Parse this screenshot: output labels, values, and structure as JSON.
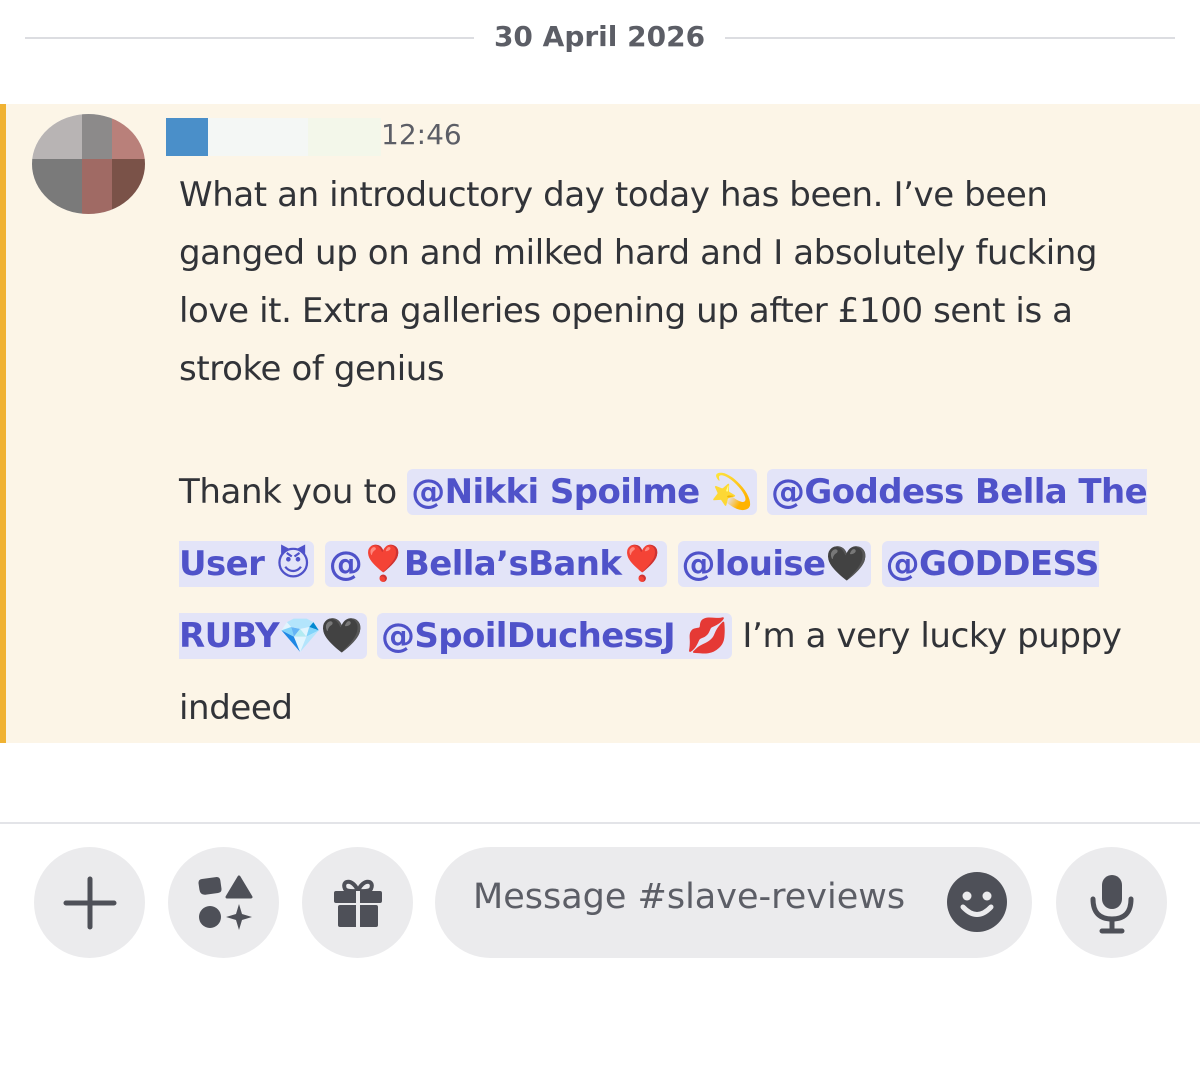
{
  "date_divider": "30 April 2026",
  "message": {
    "timestamp": "12:46",
    "paragraph1": "What an introductory day today has been. I’ve been ganged up on and milked hard and I absolutely fucking love it. Extra galleries opening up after £100 sent is a stroke of genius",
    "thanks_prefix": "Thank you to ",
    "mentions": [
      "@Nikki Spoilme 💫",
      "@Goddess Bella The User 😈",
      "@❣️Bella’sBank❣️",
      "@louise🖤",
      "@GODDESS RUBY💎🖤",
      "@SpoilDuchessJ 💋"
    ],
    "thanks_suffix": " I’m a very lucky puppy indeed"
  },
  "composer": {
    "placeholder": "Message #slave-reviews",
    "buttons": [
      "plus-icon",
      "apps-icon",
      "gift-icon",
      "emoji-icon",
      "microphone-icon"
    ]
  },
  "colors": {
    "highlight_bg": "#fcf5e7",
    "accent_bar": "#f0b232",
    "mention_bg": "#e3e4f8",
    "mention_text": "#4f52c9"
  }
}
